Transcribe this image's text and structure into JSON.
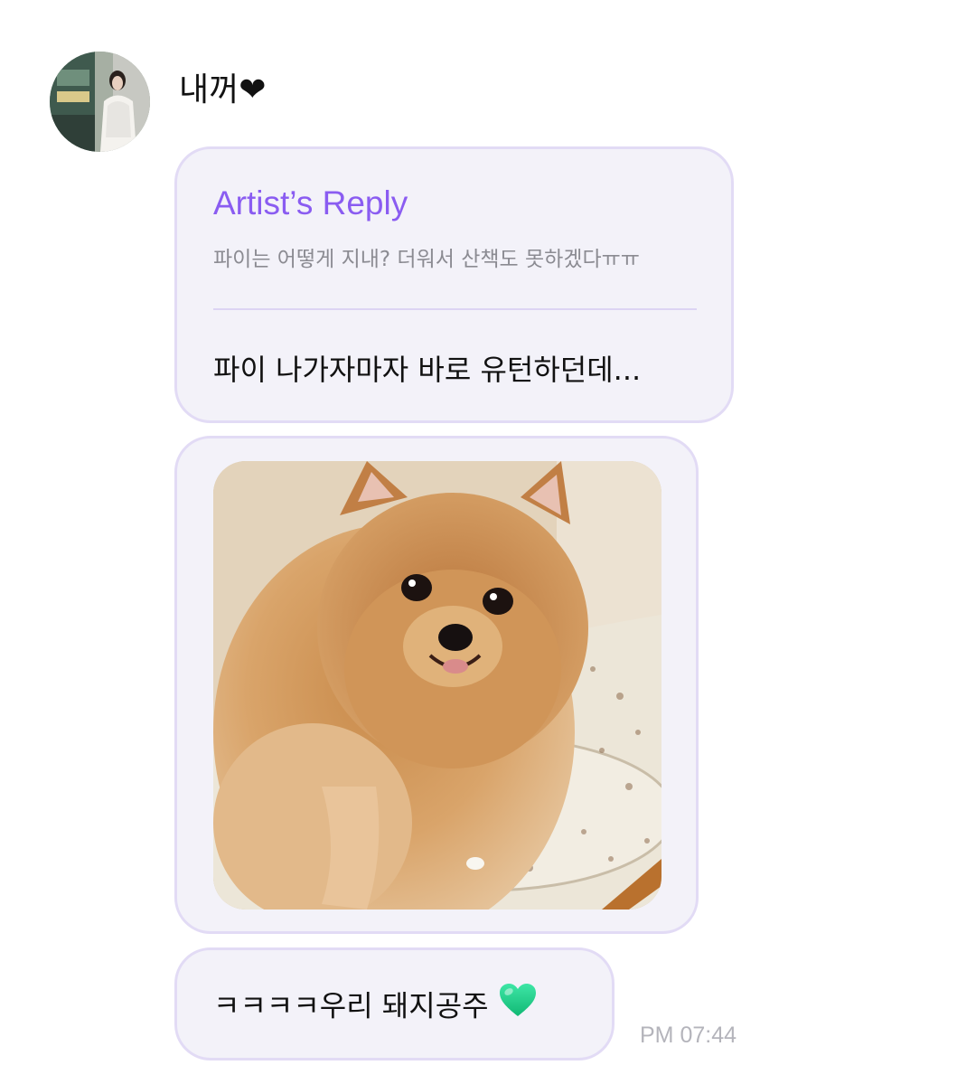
{
  "sender": {
    "name": "내꺼❤"
  },
  "reply": {
    "title": "Artist’s Reply",
    "quoted_message": "파이는 어떻게 지내? 더워서 산책도 못하겠다ㅠㅠ",
    "answer": "파이 나가자마자 바로 유턴하던데..."
  },
  "message": {
    "text": "ㅋㅋㅋㅋ우리 돼지공주",
    "emoji": "green-heart-icon",
    "timestamp": "PM 07:44"
  },
  "colors": {
    "accent": "#8a5cf1",
    "bubble_bg": "#f3f2f9",
    "bubble_border": "#e2dbf5",
    "timestamp": "#b4b4bb",
    "emoji_heart": "#22d38c"
  }
}
